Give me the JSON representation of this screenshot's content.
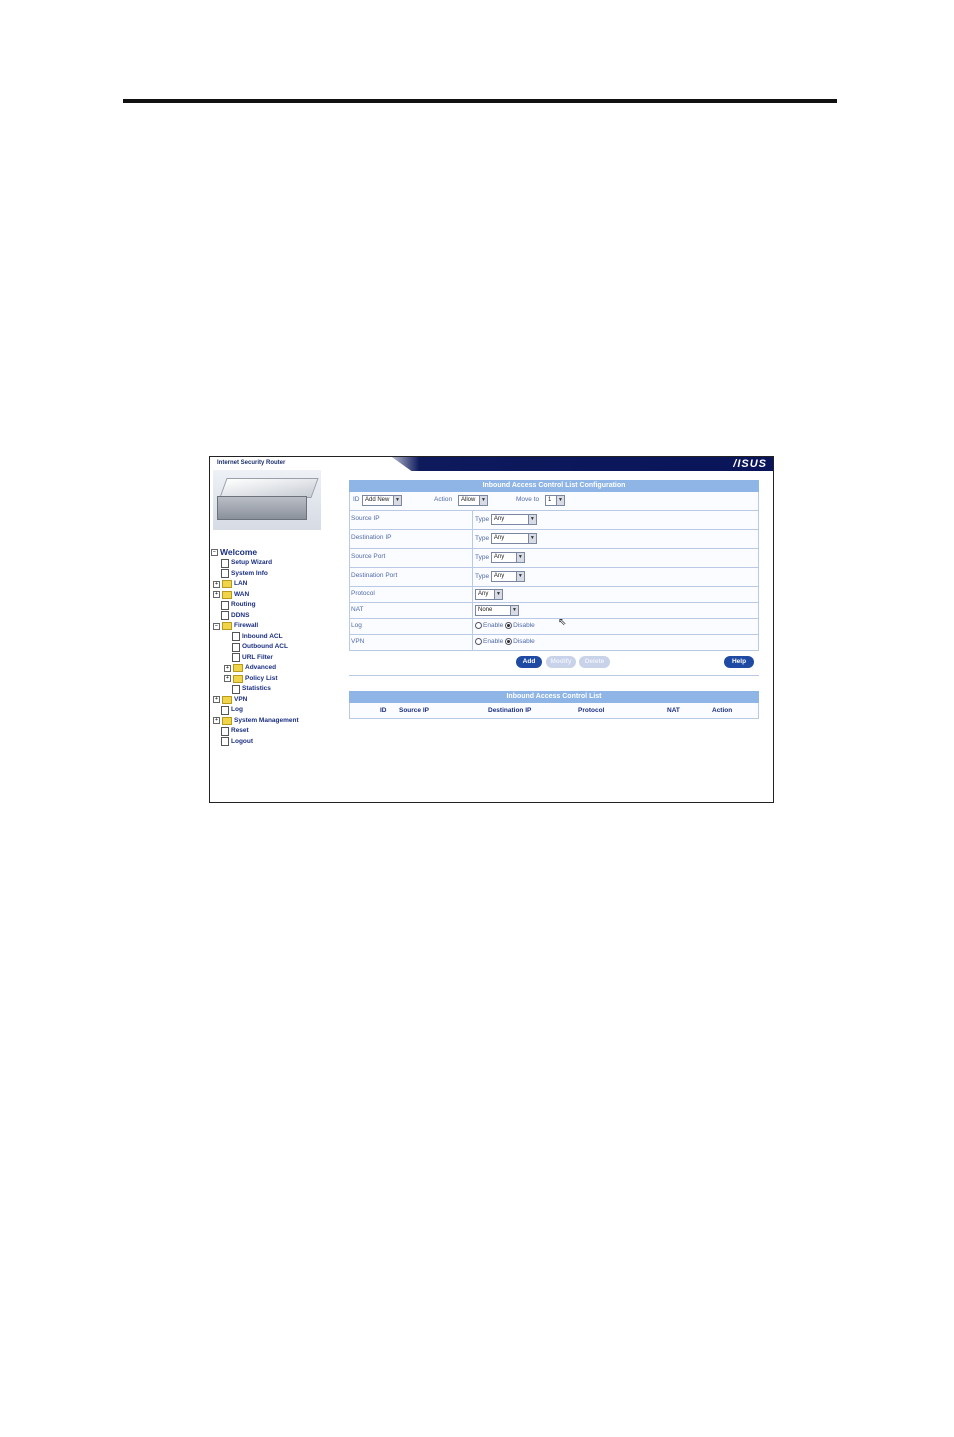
{
  "product": {
    "title": "Internet Security Router",
    "brand_logo": "/ISUS"
  },
  "tree": [
    {
      "label": "Welcome",
      "kind": "minus-folder"
    },
    {
      "label": "Setup Wizard",
      "kind": "page"
    },
    {
      "label": "System Info",
      "kind": "page"
    },
    {
      "label": "LAN",
      "kind": "plus-folder"
    },
    {
      "label": "WAN",
      "kind": "plus-folder"
    },
    {
      "label": "Routing",
      "kind": "page"
    },
    {
      "label": "DDNS",
      "kind": "page"
    },
    {
      "label": "Firewall",
      "kind": "minus-folder"
    },
    {
      "label": "Inbound ACL",
      "kind": "page"
    },
    {
      "label": "Outbound ACL",
      "kind": "page"
    },
    {
      "label": "URL Filter",
      "kind": "page"
    },
    {
      "label": "Advanced",
      "kind": "plus-folder"
    },
    {
      "label": "Policy List",
      "kind": "plus-folder"
    },
    {
      "label": "Statistics",
      "kind": "page"
    },
    {
      "label": "VPN",
      "kind": "plus-folder"
    },
    {
      "label": "Log",
      "kind": "page"
    },
    {
      "label": "System Management",
      "kind": "plus-folder"
    },
    {
      "label": "Reset",
      "kind": "page"
    },
    {
      "label": "Logout",
      "kind": "page"
    }
  ],
  "config": {
    "title": "Inbound Access Control List Configuration",
    "id_label": "ID",
    "id_value": "Add New",
    "action_label": "Action",
    "action_value": "Allow",
    "move_label": "Move to",
    "move_value": "1",
    "source_ip_label": "Source IP",
    "dest_ip_label": "Destination IP",
    "source_port_label": "Source Port",
    "dest_port_label": "Destination Port",
    "type_label": "Type",
    "any": "Any",
    "protocol_label": "Protocol",
    "nat_label": "NAT",
    "nat_value": "None",
    "log_label": "Log",
    "vpn_label": "VPN",
    "enable": "Enable",
    "disable": "Disable",
    "btn_add": "Add",
    "btn_modify": "Modify",
    "btn_delete": "Delete",
    "btn_help": "Help"
  },
  "list": {
    "title": "Inbound Access Control List",
    "columns": [
      "ID",
      "Source IP",
      "Destination IP",
      "Protocol",
      "NAT",
      "Action"
    ]
  }
}
